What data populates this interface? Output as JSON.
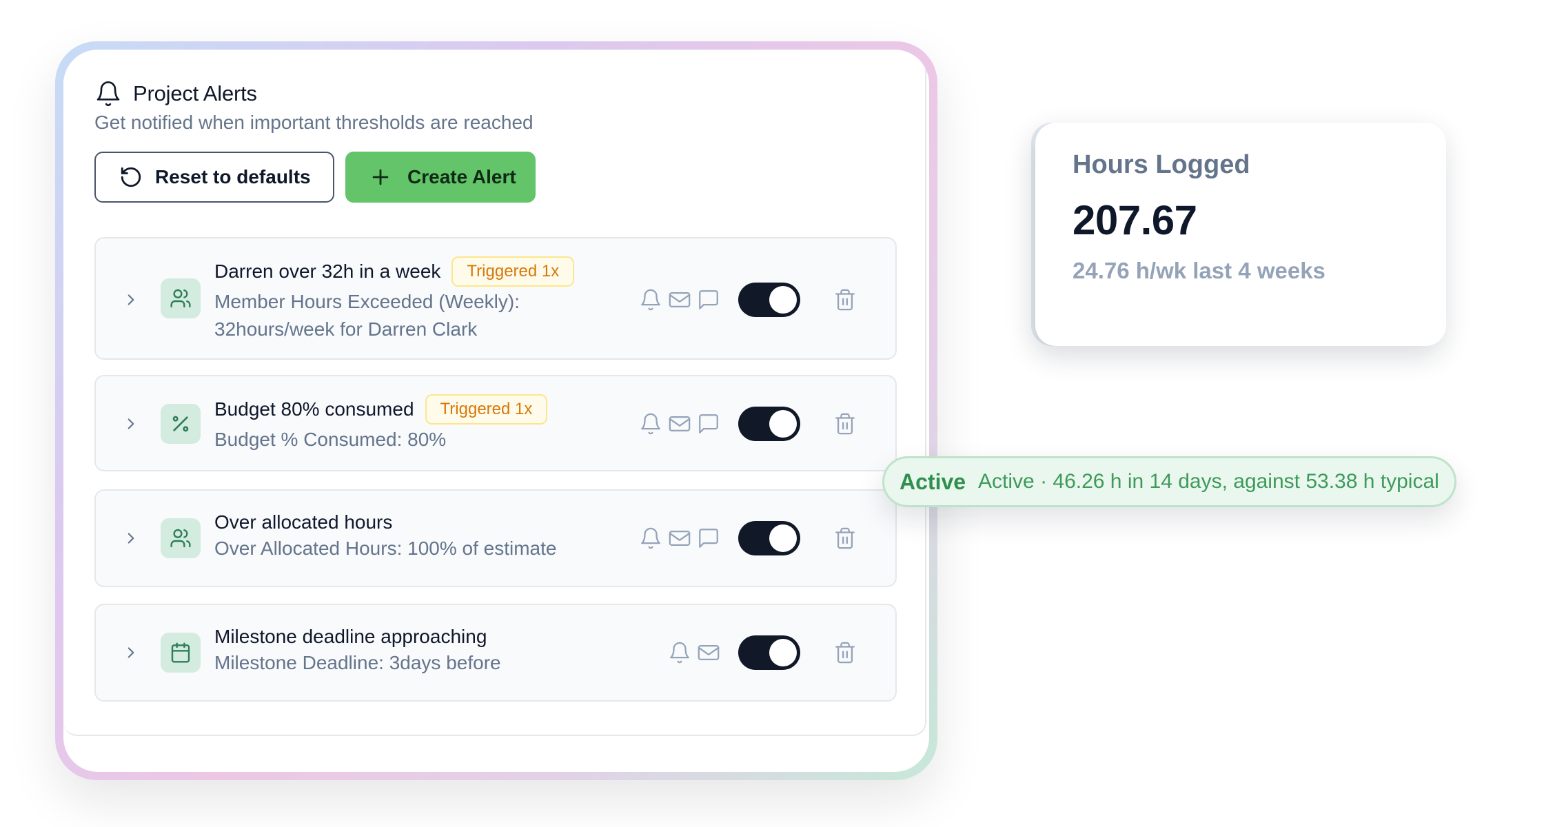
{
  "header": {
    "title": "Project Alerts",
    "subtitle": "Get notified when important thresholds are reached",
    "icon": "bell-icon"
  },
  "buttons": {
    "reset_label": "Reset to defaults",
    "create_label": "Create Alert"
  },
  "alerts": [
    {
      "name": "Darren over 32h in a week",
      "badge": "Triggered 1x",
      "desc_line1": "Member Hours Exceeded (Weekly):",
      "desc_line2": "32hours/week for Darren Clark",
      "type_icon": "users-icon",
      "channels": [
        "bell-icon",
        "mail-icon",
        "message-icon"
      ],
      "enabled": true
    },
    {
      "name": "Budget 80% consumed",
      "badge": "Triggered 1x",
      "desc_line1": "Budget % Consumed: 80%",
      "type_icon": "percent-icon",
      "channels": [
        "bell-icon",
        "mail-icon",
        "message-icon"
      ],
      "enabled": true
    },
    {
      "name": "Over allocated hours",
      "desc_line1": "Over Allocated Hours: 100% of estimate",
      "type_icon": "users-icon",
      "channels": [
        "bell-icon",
        "mail-icon",
        "message-icon"
      ],
      "enabled": true
    },
    {
      "name": "Milestone deadline approaching",
      "desc_line1": "Milestone Deadline: 3days before",
      "type_icon": "calendar-icon",
      "channels": [
        "bell-icon",
        "mail-icon"
      ],
      "enabled": true
    }
  ],
  "hours_card": {
    "label": "Hours Logged",
    "value": "207.67",
    "sub": "24.76 h/wk last 4 weeks"
  },
  "active_pill": {
    "label": "Active",
    "text": "Active · 46.26 h in 14 days, against 53.38 h typical"
  },
  "colors": {
    "accent_green": "#63c469",
    "badge_amber": "#d97706",
    "toggle_on": "#111827",
    "icon_bg": "#d3ecdf",
    "icon_green": "#2f7d57"
  }
}
